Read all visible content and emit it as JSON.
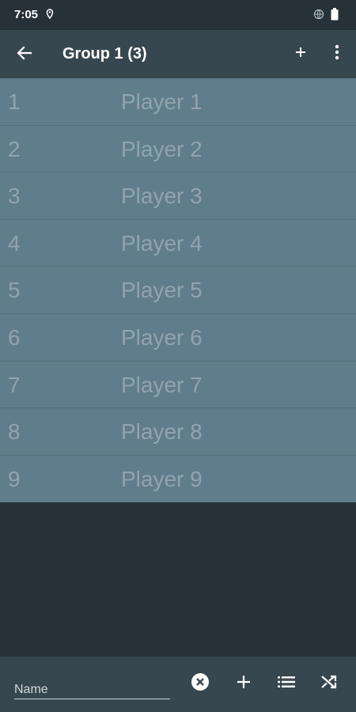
{
  "status": {
    "time": "7:05"
  },
  "appbar": {
    "title": "Group 1 (3)"
  },
  "players": [
    {
      "num": "1",
      "name": "Player 1"
    },
    {
      "num": "2",
      "name": "Player 2"
    },
    {
      "num": "3",
      "name": "Player 3"
    },
    {
      "num": "4",
      "name": "Player 4"
    },
    {
      "num": "5",
      "name": "Player 5"
    },
    {
      "num": "6",
      "name": "Player 6"
    },
    {
      "num": "7",
      "name": "Player 7"
    },
    {
      "num": "8",
      "name": "Player 8"
    },
    {
      "num": "9",
      "name": "Player 9"
    }
  ],
  "bottom": {
    "name_placeholder": "Name"
  },
  "colors": {
    "background": "#263238",
    "toolbar": "#37474f",
    "row": "#607d8b",
    "row_text": "#90a4ae"
  },
  "icons": [
    "location-icon",
    "globe-icon",
    "battery-icon",
    "back-arrow-icon",
    "plus-icon",
    "more-vert-icon",
    "clear-circle-icon",
    "list-icon",
    "shuffle-icon"
  ]
}
